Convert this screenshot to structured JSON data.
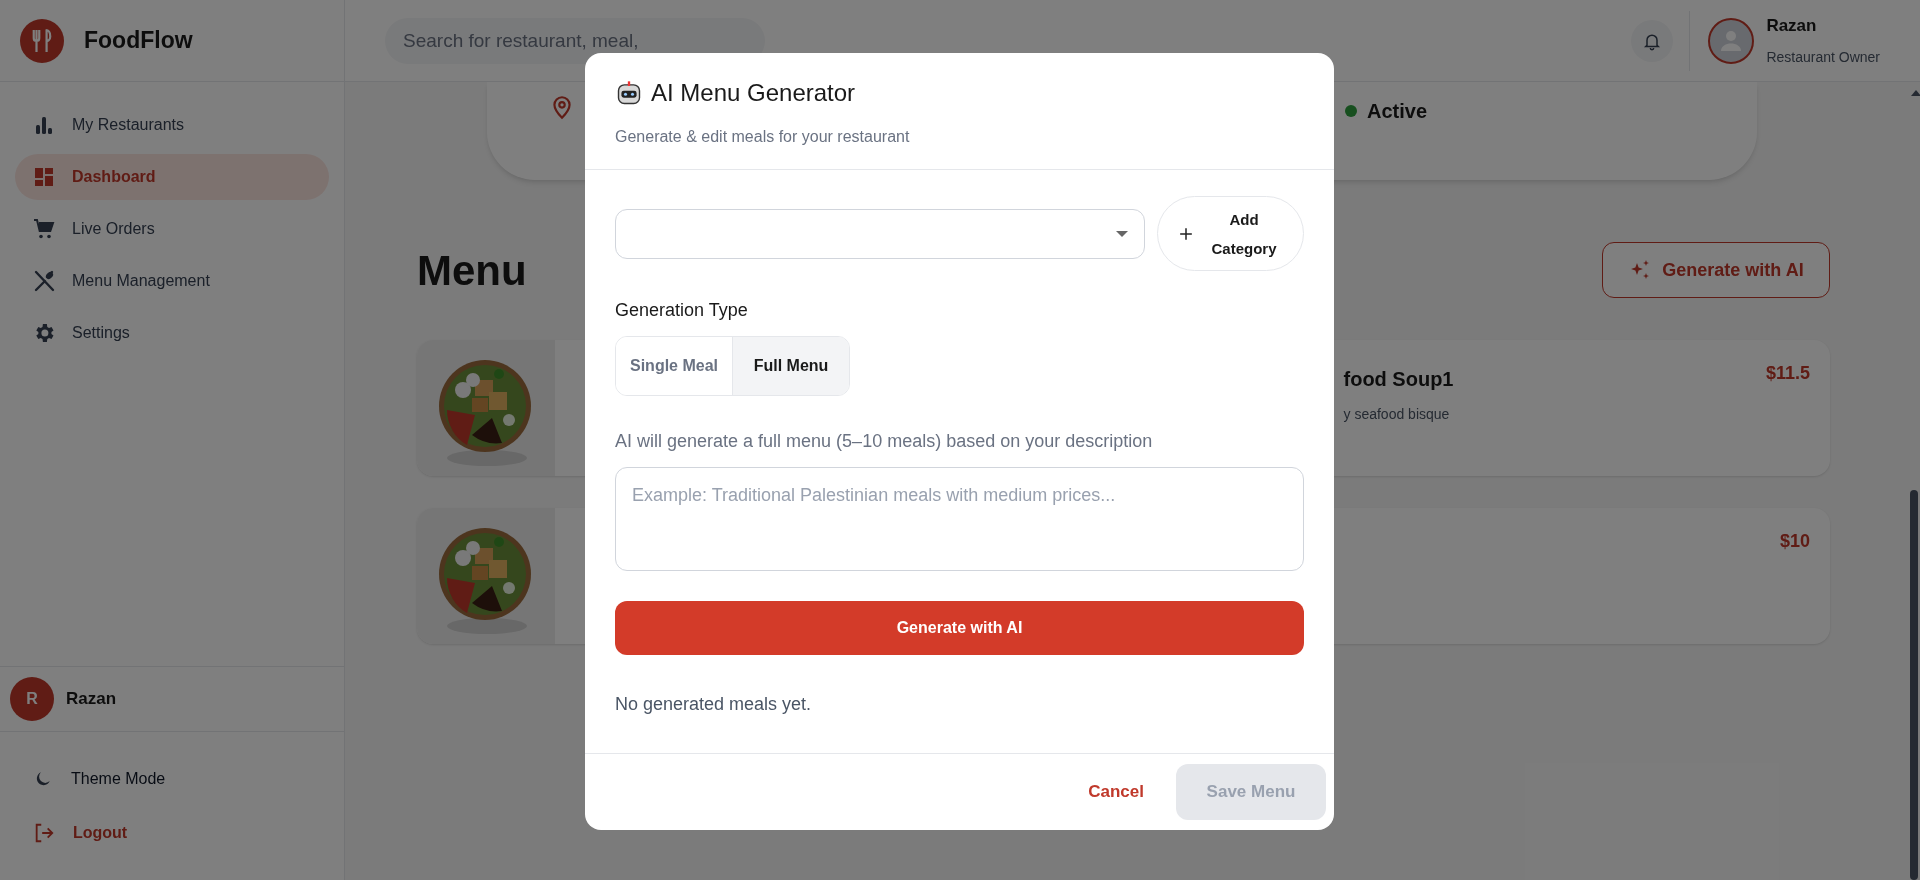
{
  "sidebar": {
    "logo": "FoodFlow",
    "items": [
      {
        "label": "My Restaurants",
        "kind": "bars",
        "selected": false
      },
      {
        "label": "Dashboard",
        "kind": "grid",
        "selected": true
      },
      {
        "label": "Live Orders",
        "kind": "cart",
        "selected": false
      },
      {
        "label": "Menu Management",
        "kind": "utensils",
        "selected": false
      },
      {
        "label": "Settings",
        "kind": "gear",
        "selected": false
      }
    ],
    "user": {
      "initial": "R",
      "name": "Razan"
    },
    "footer": [
      {
        "label": "Theme Mode",
        "kind": "theme"
      },
      {
        "label": "Logout",
        "kind": "logout"
      }
    ]
  },
  "header": {
    "search": {
      "placeholder": "Search for restaurant, meal,"
    },
    "user": {
      "name": "Razan",
      "role": "Restaurant Owner"
    }
  },
  "status_card": {
    "status": "Active"
  },
  "menu": {
    "title": "Menu",
    "generate_button": "Generate with AI",
    "right_cards": [
      {
        "title": "food Soup1",
        "description": "y seafood bisque",
        "price": "$11.5"
      },
      {
        "price": "$10"
      }
    ]
  },
  "modal": {
    "title": "AI Menu Generator",
    "subtitle": "Generate & edit meals for your restaurant",
    "add_category_button": "Add Category",
    "generation_type": {
      "label": "Generation Type",
      "options": [
        {
          "label": "Single Meal",
          "selected": false
        },
        {
          "label": "Full Menu",
          "selected": true
        }
      ]
    },
    "hint": "AI will generate a full menu (5–10 meals) based on your description",
    "description_field": {
      "placeholder": "Example: Traditional Palestinian meals with medium prices..."
    },
    "generate_button": "Generate with AI",
    "empty_message": "No generated meals yet.",
    "cancel_button": "Cancel",
    "save_button": {
      "label": "Save Menu",
      "disabled": true
    }
  }
}
